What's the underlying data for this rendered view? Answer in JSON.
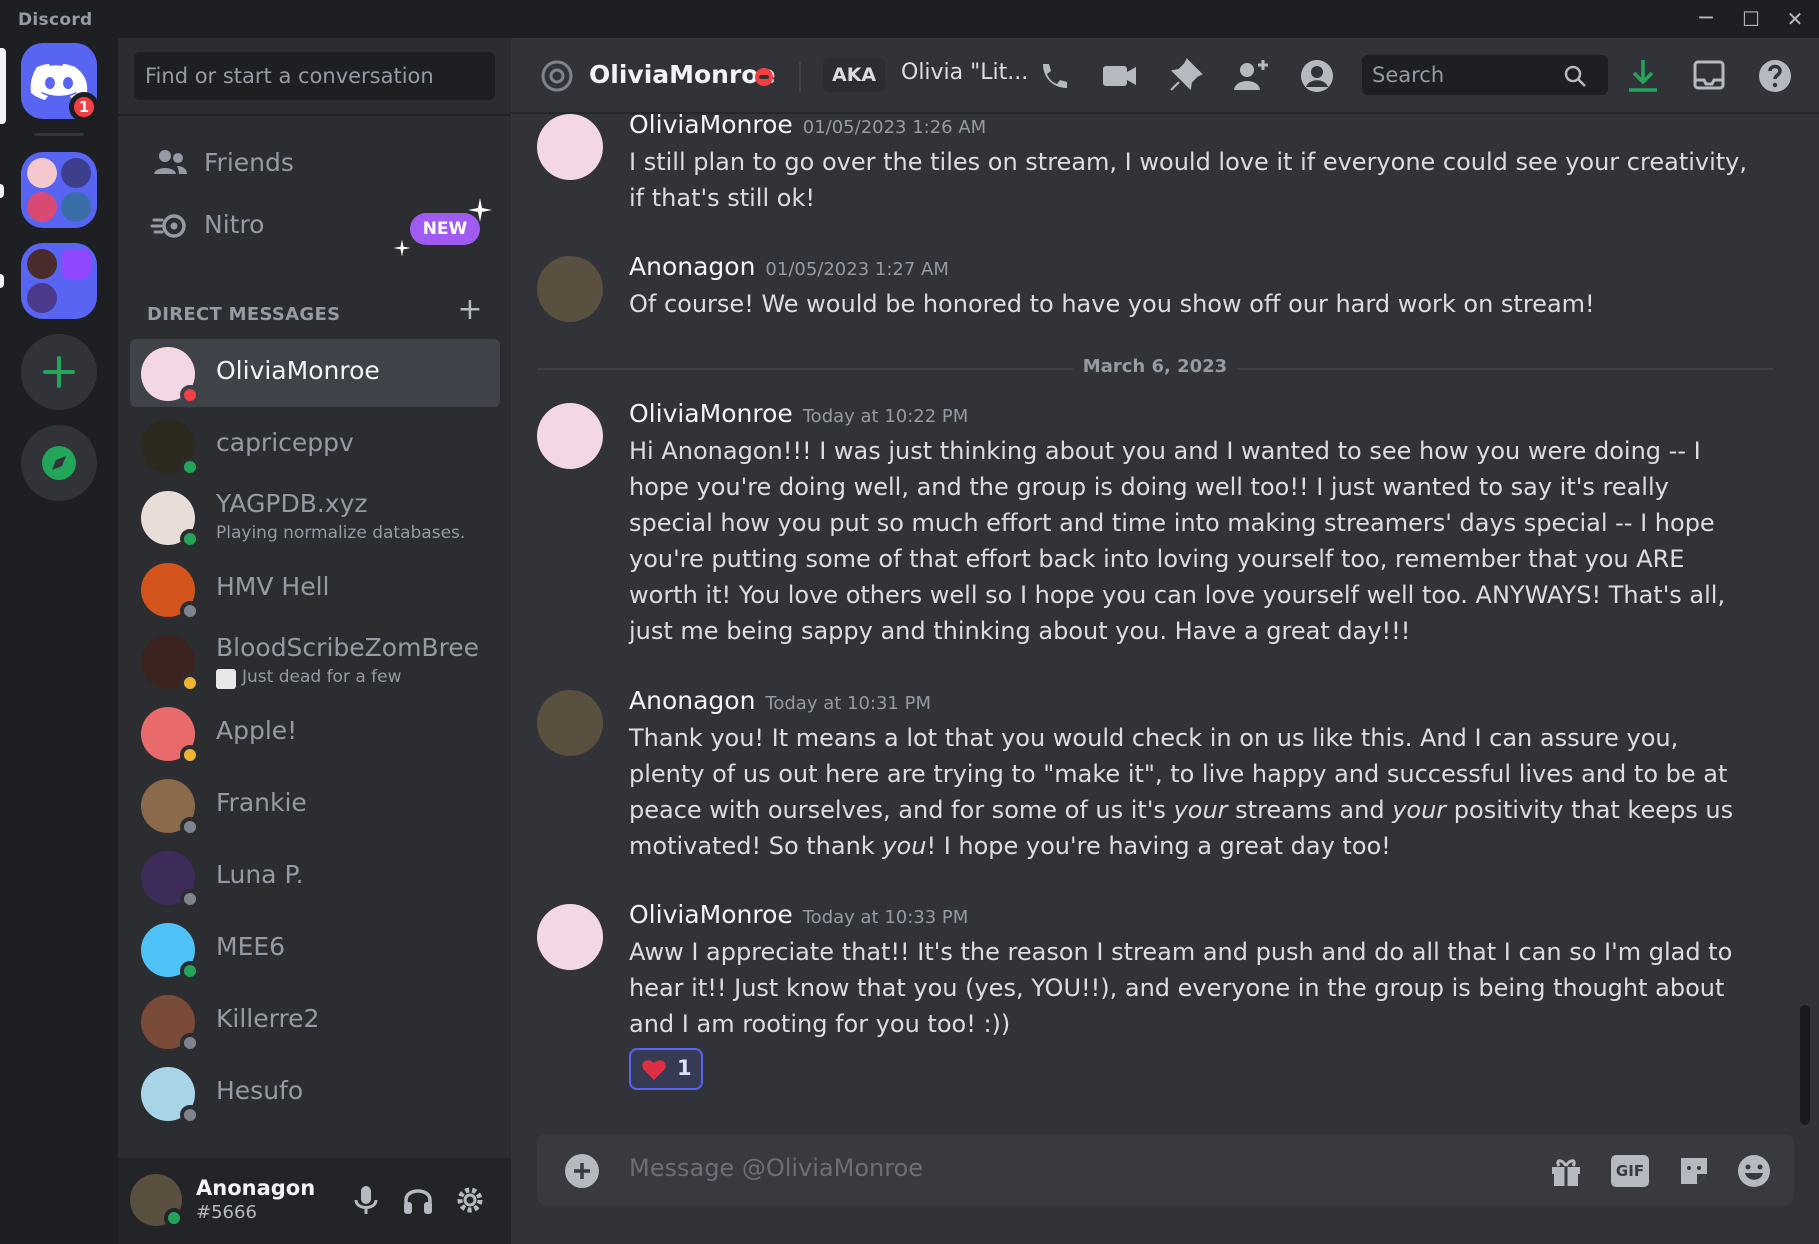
{
  "app": {
    "title": "Discord"
  },
  "window": {
    "minimize": "─",
    "maximize": "☐",
    "close": "✕"
  },
  "servers": {
    "home_badge": "1"
  },
  "sidebar": {
    "search_placeholder": "Find or start a conversation",
    "friends_label": "Friends",
    "nitro_label": "Nitro",
    "nitro_badge": "NEW",
    "dm_header": "DIRECT MESSAGES",
    "dms": [
      {
        "name": "OliviaMonroe",
        "status": "dnd",
        "active": true
      },
      {
        "name": "capriceppv",
        "status": "online"
      },
      {
        "name": "YAGPDB.xyz",
        "subtitle": "Playing normalize databases.",
        "status": "online"
      },
      {
        "name": "HMV Hell",
        "status": "offline"
      },
      {
        "name": "BloodScribeZomBree",
        "subtitle": "Just dead for a few",
        "status": "idle"
      },
      {
        "name": "Apple!",
        "status": "idle"
      },
      {
        "name": "Frankie",
        "status": "offline"
      },
      {
        "name": "Luna P.",
        "status": "offline"
      },
      {
        "name": "MEE6",
        "status": "online"
      },
      {
        "name": "Killerre2",
        "status": "offline"
      },
      {
        "name": "Hesufo",
        "status": "offline"
      }
    ]
  },
  "user_panel": {
    "username": "Anonagon",
    "tag": "#5666"
  },
  "header": {
    "name": "OliviaMonroe",
    "aka_label": "AKA",
    "aka_name": "Olivia \"Lit...",
    "search_placeholder": "Search"
  },
  "messages": [
    {
      "author": "OliviaMonroe",
      "timestamp": "01/05/2023 1:26 AM",
      "text": "I still plan to go over the tiles on stream, I would love it if everyone could see your creativity, if that's still ok!"
    },
    {
      "author": "Anonagon",
      "timestamp": "01/05/2023 1:27 AM",
      "text": "Of course! We would be honored to have you show off our hard work on stream!"
    },
    {
      "author": "OliviaMonroe",
      "timestamp": "Today at 10:22 PM",
      "text": "Hi Anonagon!!! I was just thinking about you and I wanted to see how you were doing -- I hope you're doing well, and the group is doing well too!! I just wanted to say it's really special how you put so much effort and time into making streamers' days special -- I hope you're putting some of that effort back into loving yourself too, remember that you ARE worth it! You love others well so I hope you can love yourself well too. ANYWAYS! That's all, just me being sappy and thinking about you. Have a great day!!!"
    },
    {
      "author": "Anonagon",
      "timestamp": "Today at 10:31 PM",
      "text_parts": [
        "Thank you! It means a lot that you would check in on us like this. And I can assure you, plenty of us out here are trying to \"make it\", to live happy and successful lives and to be at peace with ourselves, and for some of us it's ",
        "your",
        " streams and ",
        "your",
        " positivity that keeps us motivated! So thank ",
        "you",
        "! I hope you're having a great day too!"
      ]
    },
    {
      "author": "OliviaMonroe",
      "timestamp": "Today at 10:33 PM",
      "text": "Aww I appreciate that!! It's the reason I stream and push and do all that I can so I'm glad to hear it!! Just know that you (yes, YOU!!), and everyone in the group is being thought about and I am rooting for you too! :))",
      "reaction": {
        "emoji": "heart",
        "count": "1"
      }
    }
  ],
  "date_separator": "March 6, 2023",
  "composer": {
    "placeholder": "Message @OliviaMonroe",
    "gif_label": "GIF"
  },
  "colors": {
    "accent": "#5865f2",
    "green": "#23a55a",
    "dnd": "#f23f43",
    "idle": "#f0b232",
    "offline": "#80848e",
    "nitro": "#a05cf0"
  }
}
